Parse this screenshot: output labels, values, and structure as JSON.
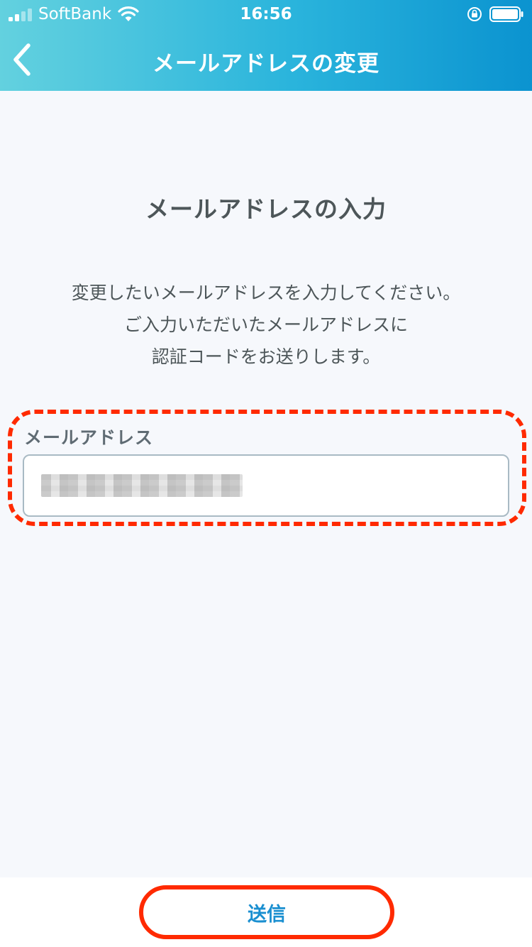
{
  "status_bar": {
    "carrier": "SoftBank",
    "time": "16:56"
  },
  "nav": {
    "title": "メールアドレスの変更",
    "back_icon": "chevron-left-icon"
  },
  "content": {
    "heading": "メールアドレスの入力",
    "description_lines": [
      "変更したいメールアドレスを入力してください。",
      "ご入力いただいたメールアドレスに",
      "認証コードをお送りします。"
    ],
    "email_label": "メールアドレス",
    "email_value": ""
  },
  "footer": {
    "submit_label": "送信"
  },
  "colors": {
    "header_start": "#63d1df",
    "header_end": "#0b93d0",
    "highlight": "#ff2a00",
    "button_text": "#1a8fd0",
    "text": "#4d5659"
  }
}
